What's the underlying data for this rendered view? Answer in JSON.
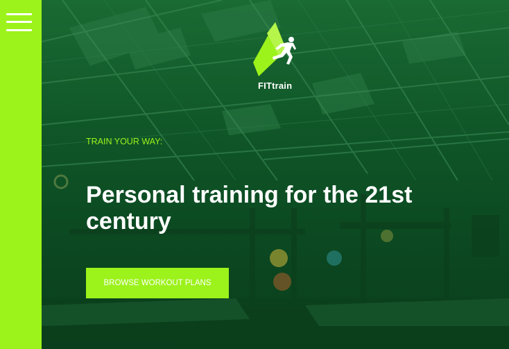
{
  "brand": {
    "name": "FITtrain"
  },
  "nav": {
    "menu_icon": "hamburger-menu-icon"
  },
  "hero": {
    "eyebrow": "TRAIN YOUR WAY:",
    "headline": "Personal training for the 21st century",
    "cta_label": "BROWSE WORKOUT PLANS"
  },
  "colors": {
    "accent": "#9cf21b",
    "overlay": "#0e4a22",
    "text": "#ffffff"
  }
}
